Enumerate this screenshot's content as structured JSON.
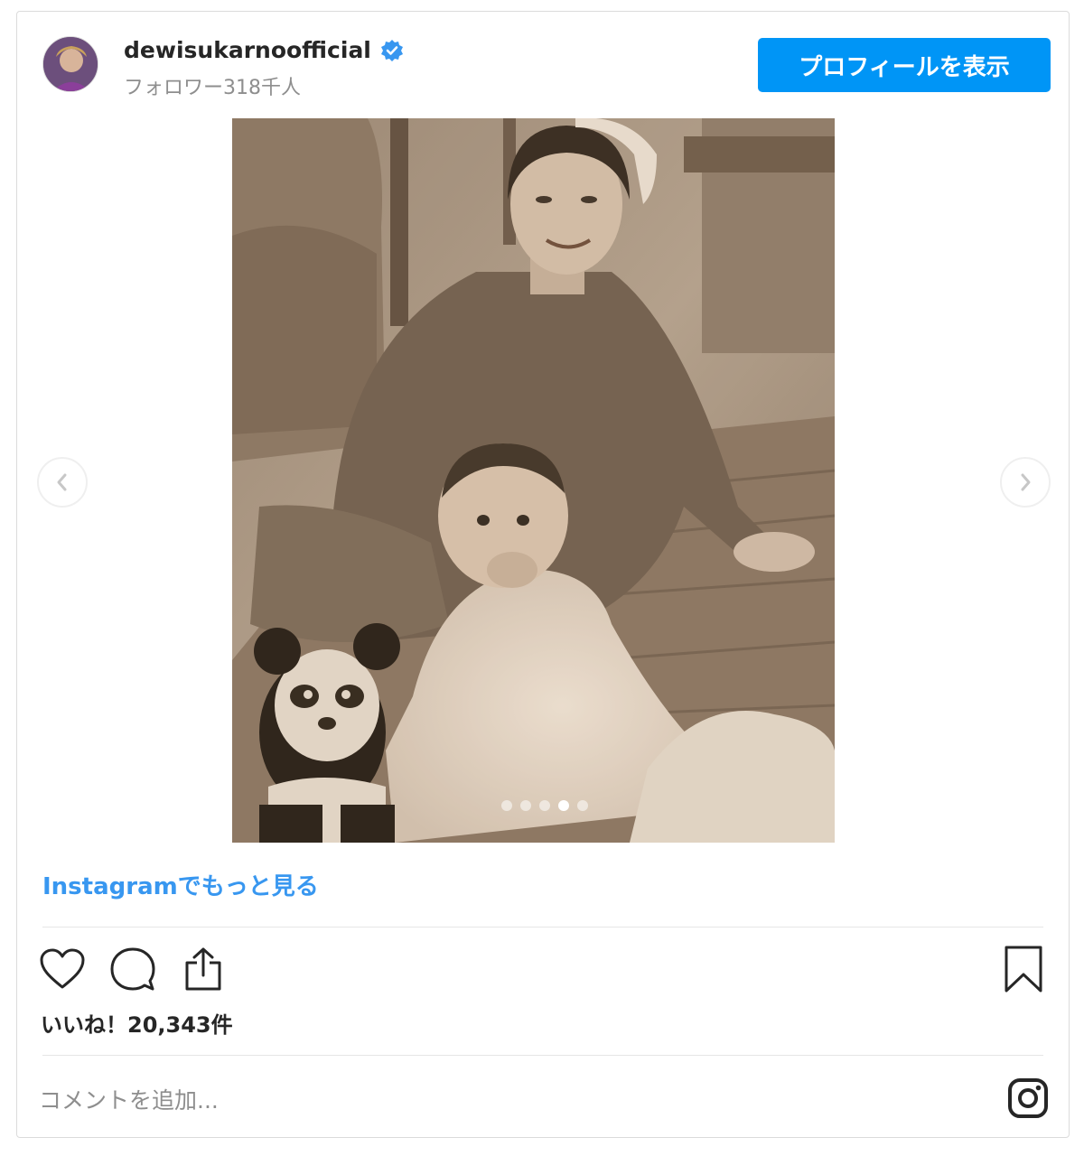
{
  "header": {
    "username": "dewisukarnoofficial",
    "verified_icon": "verified-badge-icon",
    "followers": "フォロワー318千人",
    "profile_button": "プロフィールを表示"
  },
  "media": {
    "carousel_dots": 5,
    "active_dot": 4,
    "prev_icon": "chevron-left-icon",
    "next_icon": "chevron-right-icon"
  },
  "more_link": "Instagramでもっと見る",
  "actions": {
    "like_icon": "heart-icon",
    "comment_icon": "comment-icon",
    "share_icon": "share-icon",
    "save_icon": "bookmark-icon"
  },
  "likes": "いいね！20,343件",
  "comment": {
    "placeholder": "コメントを追加..."
  },
  "colors": {
    "accent": "#0095f6",
    "link": "#3897f0",
    "muted": "#8e8e8e"
  }
}
